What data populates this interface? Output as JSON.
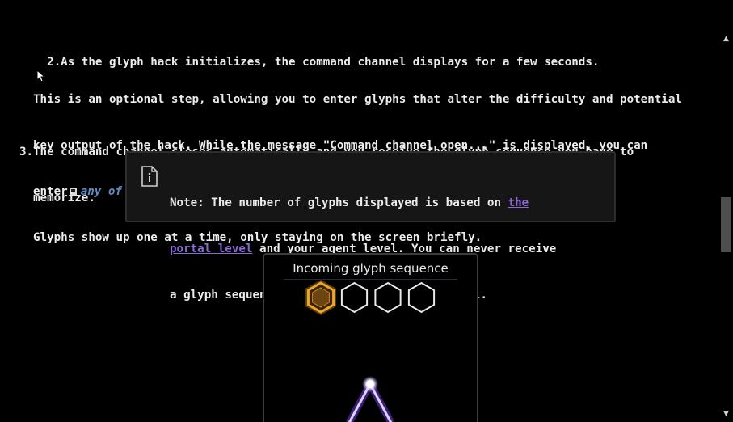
{
  "steps": [
    {
      "num": "2.",
      "text": "As the glyph hack initializes, the command channel displays for a few seconds."
    },
    {
      "num": "3.",
      "text_line1": "The command channel closes automatically and you receive the glyph sequence you have to",
      "text_line2": "memorize."
    }
  ],
  "optional_para": {
    "line1": "This is an optional step, allowing you to enter glyphs that alter the difficulty and potential",
    "line2": "key output of the hack. While the message \"Command channel open...\" is displayed, you can",
    "line3_prefix": "enter",
    "line3_link": "any of these four glyphs:"
  },
  "note": {
    "label": "Note:",
    "line1_text": " The number of glyphs displayed is based on ",
    "link_part1": "the",
    "link_part2": "portal level",
    "line2_rest": " and your agent level. You can never receive",
    "line3": "a glyph sequence more complex than your level."
  },
  "glyphs_para": "Glyphs show up one at a time, only staying on the screen briefly.",
  "game": {
    "title": "Incoming glyph sequence",
    "hexagons": [
      {
        "state": "active",
        "color": "#f0a528"
      },
      {
        "state": "empty",
        "color": "#e8e8e8"
      },
      {
        "state": "empty",
        "color": "#e8e8e8"
      },
      {
        "state": "empty",
        "color": "#e8e8e8"
      }
    ],
    "trace_color": "#9b6bff"
  },
  "icons": {
    "note": "note-document-icon",
    "inline": "glyph-inline-icon",
    "cursor": "mouse-pointer-icon",
    "scroll_up": "scroll-up-arrow-icon",
    "scroll_down": "scroll-down-arrow-icon"
  },
  "scrollbar": {
    "position_fraction": 0.42
  }
}
